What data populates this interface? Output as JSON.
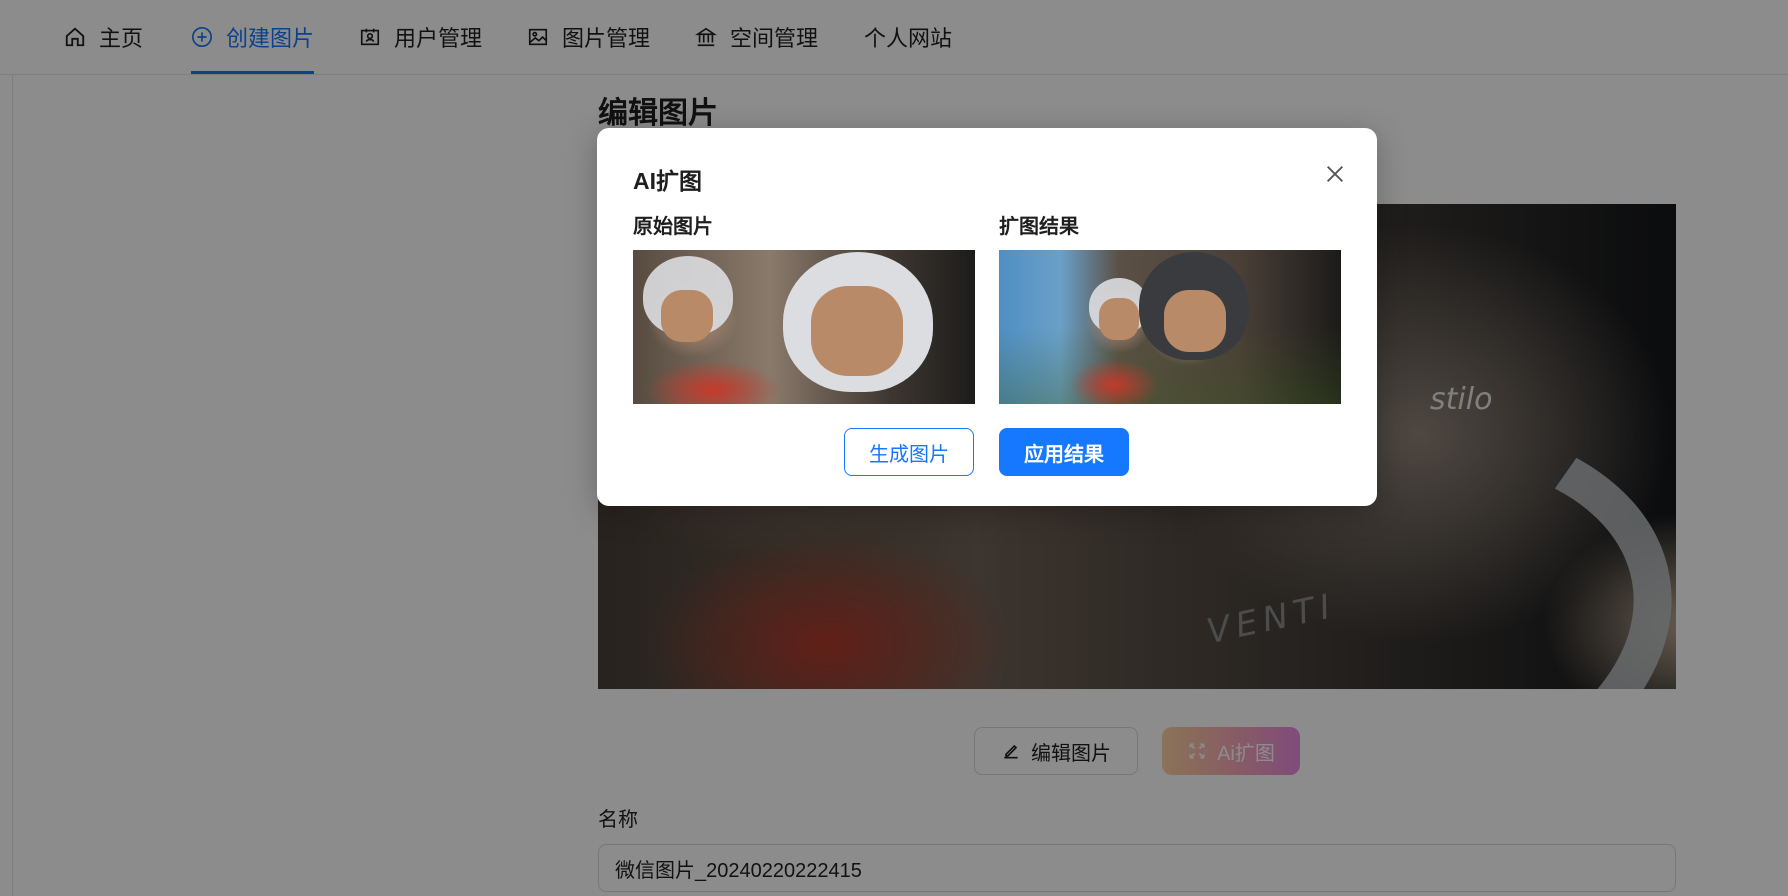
{
  "nav": {
    "items": [
      {
        "label": "主页",
        "icon": "home-icon"
      },
      {
        "label": "创建图片",
        "icon": "plus-circle-icon",
        "active": true
      },
      {
        "label": "用户管理",
        "icon": "user-card-icon"
      },
      {
        "label": "图片管理",
        "icon": "image-icon"
      },
      {
        "label": "空间管理",
        "icon": "bank-icon"
      },
      {
        "label": "个人网站",
        "icon": ""
      }
    ],
    "accent_color": "#1677ff"
  },
  "page": {
    "title": "编辑图片",
    "edit_button_label": "编辑图片",
    "ai_button_label": "Ai扩图",
    "name_label": "名称",
    "name_value": "微信图片_20240220222415",
    "image_brand_top": "stilo",
    "image_brand_bottom": "VENTI"
  },
  "modal": {
    "title": "AI扩图",
    "original_label": "原始图片",
    "result_label": "扩图结果",
    "generate_button": "生成图片",
    "apply_button": "应用结果"
  }
}
